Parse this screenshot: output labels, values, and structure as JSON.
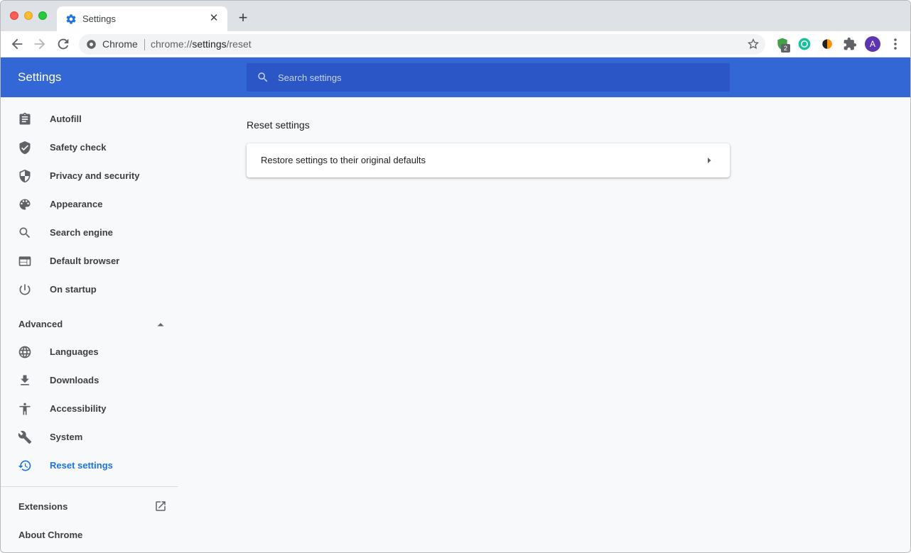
{
  "tab": {
    "title": "Settings",
    "close": "✕",
    "new_tab": "+"
  },
  "omnibox": {
    "site_label": "Chrome",
    "url_prefix": "chrome://",
    "url_host": "settings",
    "url_path": "/reset"
  },
  "extensions": {
    "badge_count": "2"
  },
  "profile": {
    "initial": "A"
  },
  "header": {
    "title": "Settings",
    "search_placeholder": "Search settings"
  },
  "sidebar": {
    "items": [
      {
        "label": "Autofill",
        "icon": "clipboard-icon"
      },
      {
        "label": "Safety check",
        "icon": "shield-check-icon"
      },
      {
        "label": "Privacy and security",
        "icon": "shield-icon"
      },
      {
        "label": "Appearance",
        "icon": "palette-icon"
      },
      {
        "label": "Search engine",
        "icon": "search-icon"
      },
      {
        "label": "Default browser",
        "icon": "browser-icon"
      },
      {
        "label": "On startup",
        "icon": "power-icon"
      }
    ],
    "advanced_label": "Advanced",
    "advanced_items": [
      {
        "label": "Languages",
        "icon": "globe-icon"
      },
      {
        "label": "Downloads",
        "icon": "download-icon"
      },
      {
        "label": "Accessibility",
        "icon": "accessibility-icon"
      },
      {
        "label": "System",
        "icon": "wrench-icon"
      },
      {
        "label": "Reset settings",
        "icon": "restore-icon",
        "active": true
      }
    ],
    "extensions_label": "Extensions",
    "about_label": "About Chrome"
  },
  "main": {
    "section_title": "Reset settings",
    "restore_label": "Restore settings to their original defaults"
  },
  "colors": {
    "accent": "#1a73e8",
    "header": "#3367d6",
    "search_box": "#2a56c6"
  }
}
